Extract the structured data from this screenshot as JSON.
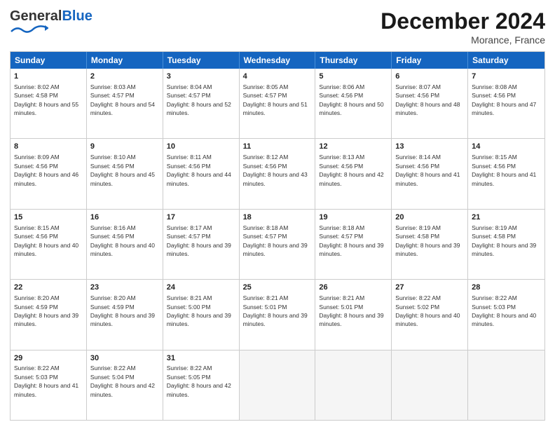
{
  "header": {
    "logo_general": "General",
    "logo_blue": "Blue",
    "title": "December 2024",
    "location": "Morance, France"
  },
  "days_of_week": [
    "Sunday",
    "Monday",
    "Tuesday",
    "Wednesday",
    "Thursday",
    "Friday",
    "Saturday"
  ],
  "weeks": [
    [
      {
        "num": "1",
        "sunrise": "Sunrise: 8:02 AM",
        "sunset": "Sunset: 4:58 PM",
        "daylight": "Daylight: 8 hours and 55 minutes."
      },
      {
        "num": "2",
        "sunrise": "Sunrise: 8:03 AM",
        "sunset": "Sunset: 4:57 PM",
        "daylight": "Daylight: 8 hours and 54 minutes."
      },
      {
        "num": "3",
        "sunrise": "Sunrise: 8:04 AM",
        "sunset": "Sunset: 4:57 PM",
        "daylight": "Daylight: 8 hours and 52 minutes."
      },
      {
        "num": "4",
        "sunrise": "Sunrise: 8:05 AM",
        "sunset": "Sunset: 4:57 PM",
        "daylight": "Daylight: 8 hours and 51 minutes."
      },
      {
        "num": "5",
        "sunrise": "Sunrise: 8:06 AM",
        "sunset": "Sunset: 4:56 PM",
        "daylight": "Daylight: 8 hours and 50 minutes."
      },
      {
        "num": "6",
        "sunrise": "Sunrise: 8:07 AM",
        "sunset": "Sunset: 4:56 PM",
        "daylight": "Daylight: 8 hours and 48 minutes."
      },
      {
        "num": "7",
        "sunrise": "Sunrise: 8:08 AM",
        "sunset": "Sunset: 4:56 PM",
        "daylight": "Daylight: 8 hours and 47 minutes."
      }
    ],
    [
      {
        "num": "8",
        "sunrise": "Sunrise: 8:09 AM",
        "sunset": "Sunset: 4:56 PM",
        "daylight": "Daylight: 8 hours and 46 minutes."
      },
      {
        "num": "9",
        "sunrise": "Sunrise: 8:10 AM",
        "sunset": "Sunset: 4:56 PM",
        "daylight": "Daylight: 8 hours and 45 minutes."
      },
      {
        "num": "10",
        "sunrise": "Sunrise: 8:11 AM",
        "sunset": "Sunset: 4:56 PM",
        "daylight": "Daylight: 8 hours and 44 minutes."
      },
      {
        "num": "11",
        "sunrise": "Sunrise: 8:12 AM",
        "sunset": "Sunset: 4:56 PM",
        "daylight": "Daylight: 8 hours and 43 minutes."
      },
      {
        "num": "12",
        "sunrise": "Sunrise: 8:13 AM",
        "sunset": "Sunset: 4:56 PM",
        "daylight": "Daylight: 8 hours and 42 minutes."
      },
      {
        "num": "13",
        "sunrise": "Sunrise: 8:14 AM",
        "sunset": "Sunset: 4:56 PM",
        "daylight": "Daylight: 8 hours and 41 minutes."
      },
      {
        "num": "14",
        "sunrise": "Sunrise: 8:15 AM",
        "sunset": "Sunset: 4:56 PM",
        "daylight": "Daylight: 8 hours and 41 minutes."
      }
    ],
    [
      {
        "num": "15",
        "sunrise": "Sunrise: 8:15 AM",
        "sunset": "Sunset: 4:56 PM",
        "daylight": "Daylight: 8 hours and 40 minutes."
      },
      {
        "num": "16",
        "sunrise": "Sunrise: 8:16 AM",
        "sunset": "Sunset: 4:56 PM",
        "daylight": "Daylight: 8 hours and 40 minutes."
      },
      {
        "num": "17",
        "sunrise": "Sunrise: 8:17 AM",
        "sunset": "Sunset: 4:57 PM",
        "daylight": "Daylight: 8 hours and 39 minutes."
      },
      {
        "num": "18",
        "sunrise": "Sunrise: 8:18 AM",
        "sunset": "Sunset: 4:57 PM",
        "daylight": "Daylight: 8 hours and 39 minutes."
      },
      {
        "num": "19",
        "sunrise": "Sunrise: 8:18 AM",
        "sunset": "Sunset: 4:57 PM",
        "daylight": "Daylight: 8 hours and 39 minutes."
      },
      {
        "num": "20",
        "sunrise": "Sunrise: 8:19 AM",
        "sunset": "Sunset: 4:58 PM",
        "daylight": "Daylight: 8 hours and 39 minutes."
      },
      {
        "num": "21",
        "sunrise": "Sunrise: 8:19 AM",
        "sunset": "Sunset: 4:58 PM",
        "daylight": "Daylight: 8 hours and 39 minutes."
      }
    ],
    [
      {
        "num": "22",
        "sunrise": "Sunrise: 8:20 AM",
        "sunset": "Sunset: 4:59 PM",
        "daylight": "Daylight: 8 hours and 39 minutes."
      },
      {
        "num": "23",
        "sunrise": "Sunrise: 8:20 AM",
        "sunset": "Sunset: 4:59 PM",
        "daylight": "Daylight: 8 hours and 39 minutes."
      },
      {
        "num": "24",
        "sunrise": "Sunrise: 8:21 AM",
        "sunset": "Sunset: 5:00 PM",
        "daylight": "Daylight: 8 hours and 39 minutes."
      },
      {
        "num": "25",
        "sunrise": "Sunrise: 8:21 AM",
        "sunset": "Sunset: 5:01 PM",
        "daylight": "Daylight: 8 hours and 39 minutes."
      },
      {
        "num": "26",
        "sunrise": "Sunrise: 8:21 AM",
        "sunset": "Sunset: 5:01 PM",
        "daylight": "Daylight: 8 hours and 39 minutes."
      },
      {
        "num": "27",
        "sunrise": "Sunrise: 8:22 AM",
        "sunset": "Sunset: 5:02 PM",
        "daylight": "Daylight: 8 hours and 40 minutes."
      },
      {
        "num": "28",
        "sunrise": "Sunrise: 8:22 AM",
        "sunset": "Sunset: 5:03 PM",
        "daylight": "Daylight: 8 hours and 40 minutes."
      }
    ],
    [
      {
        "num": "29",
        "sunrise": "Sunrise: 8:22 AM",
        "sunset": "Sunset: 5:03 PM",
        "daylight": "Daylight: 8 hours and 41 minutes."
      },
      {
        "num": "30",
        "sunrise": "Sunrise: 8:22 AM",
        "sunset": "Sunset: 5:04 PM",
        "daylight": "Daylight: 8 hours and 42 minutes."
      },
      {
        "num": "31",
        "sunrise": "Sunrise: 8:22 AM",
        "sunset": "Sunset: 5:05 PM",
        "daylight": "Daylight: 8 hours and 42 minutes."
      },
      null,
      null,
      null,
      null
    ]
  ]
}
